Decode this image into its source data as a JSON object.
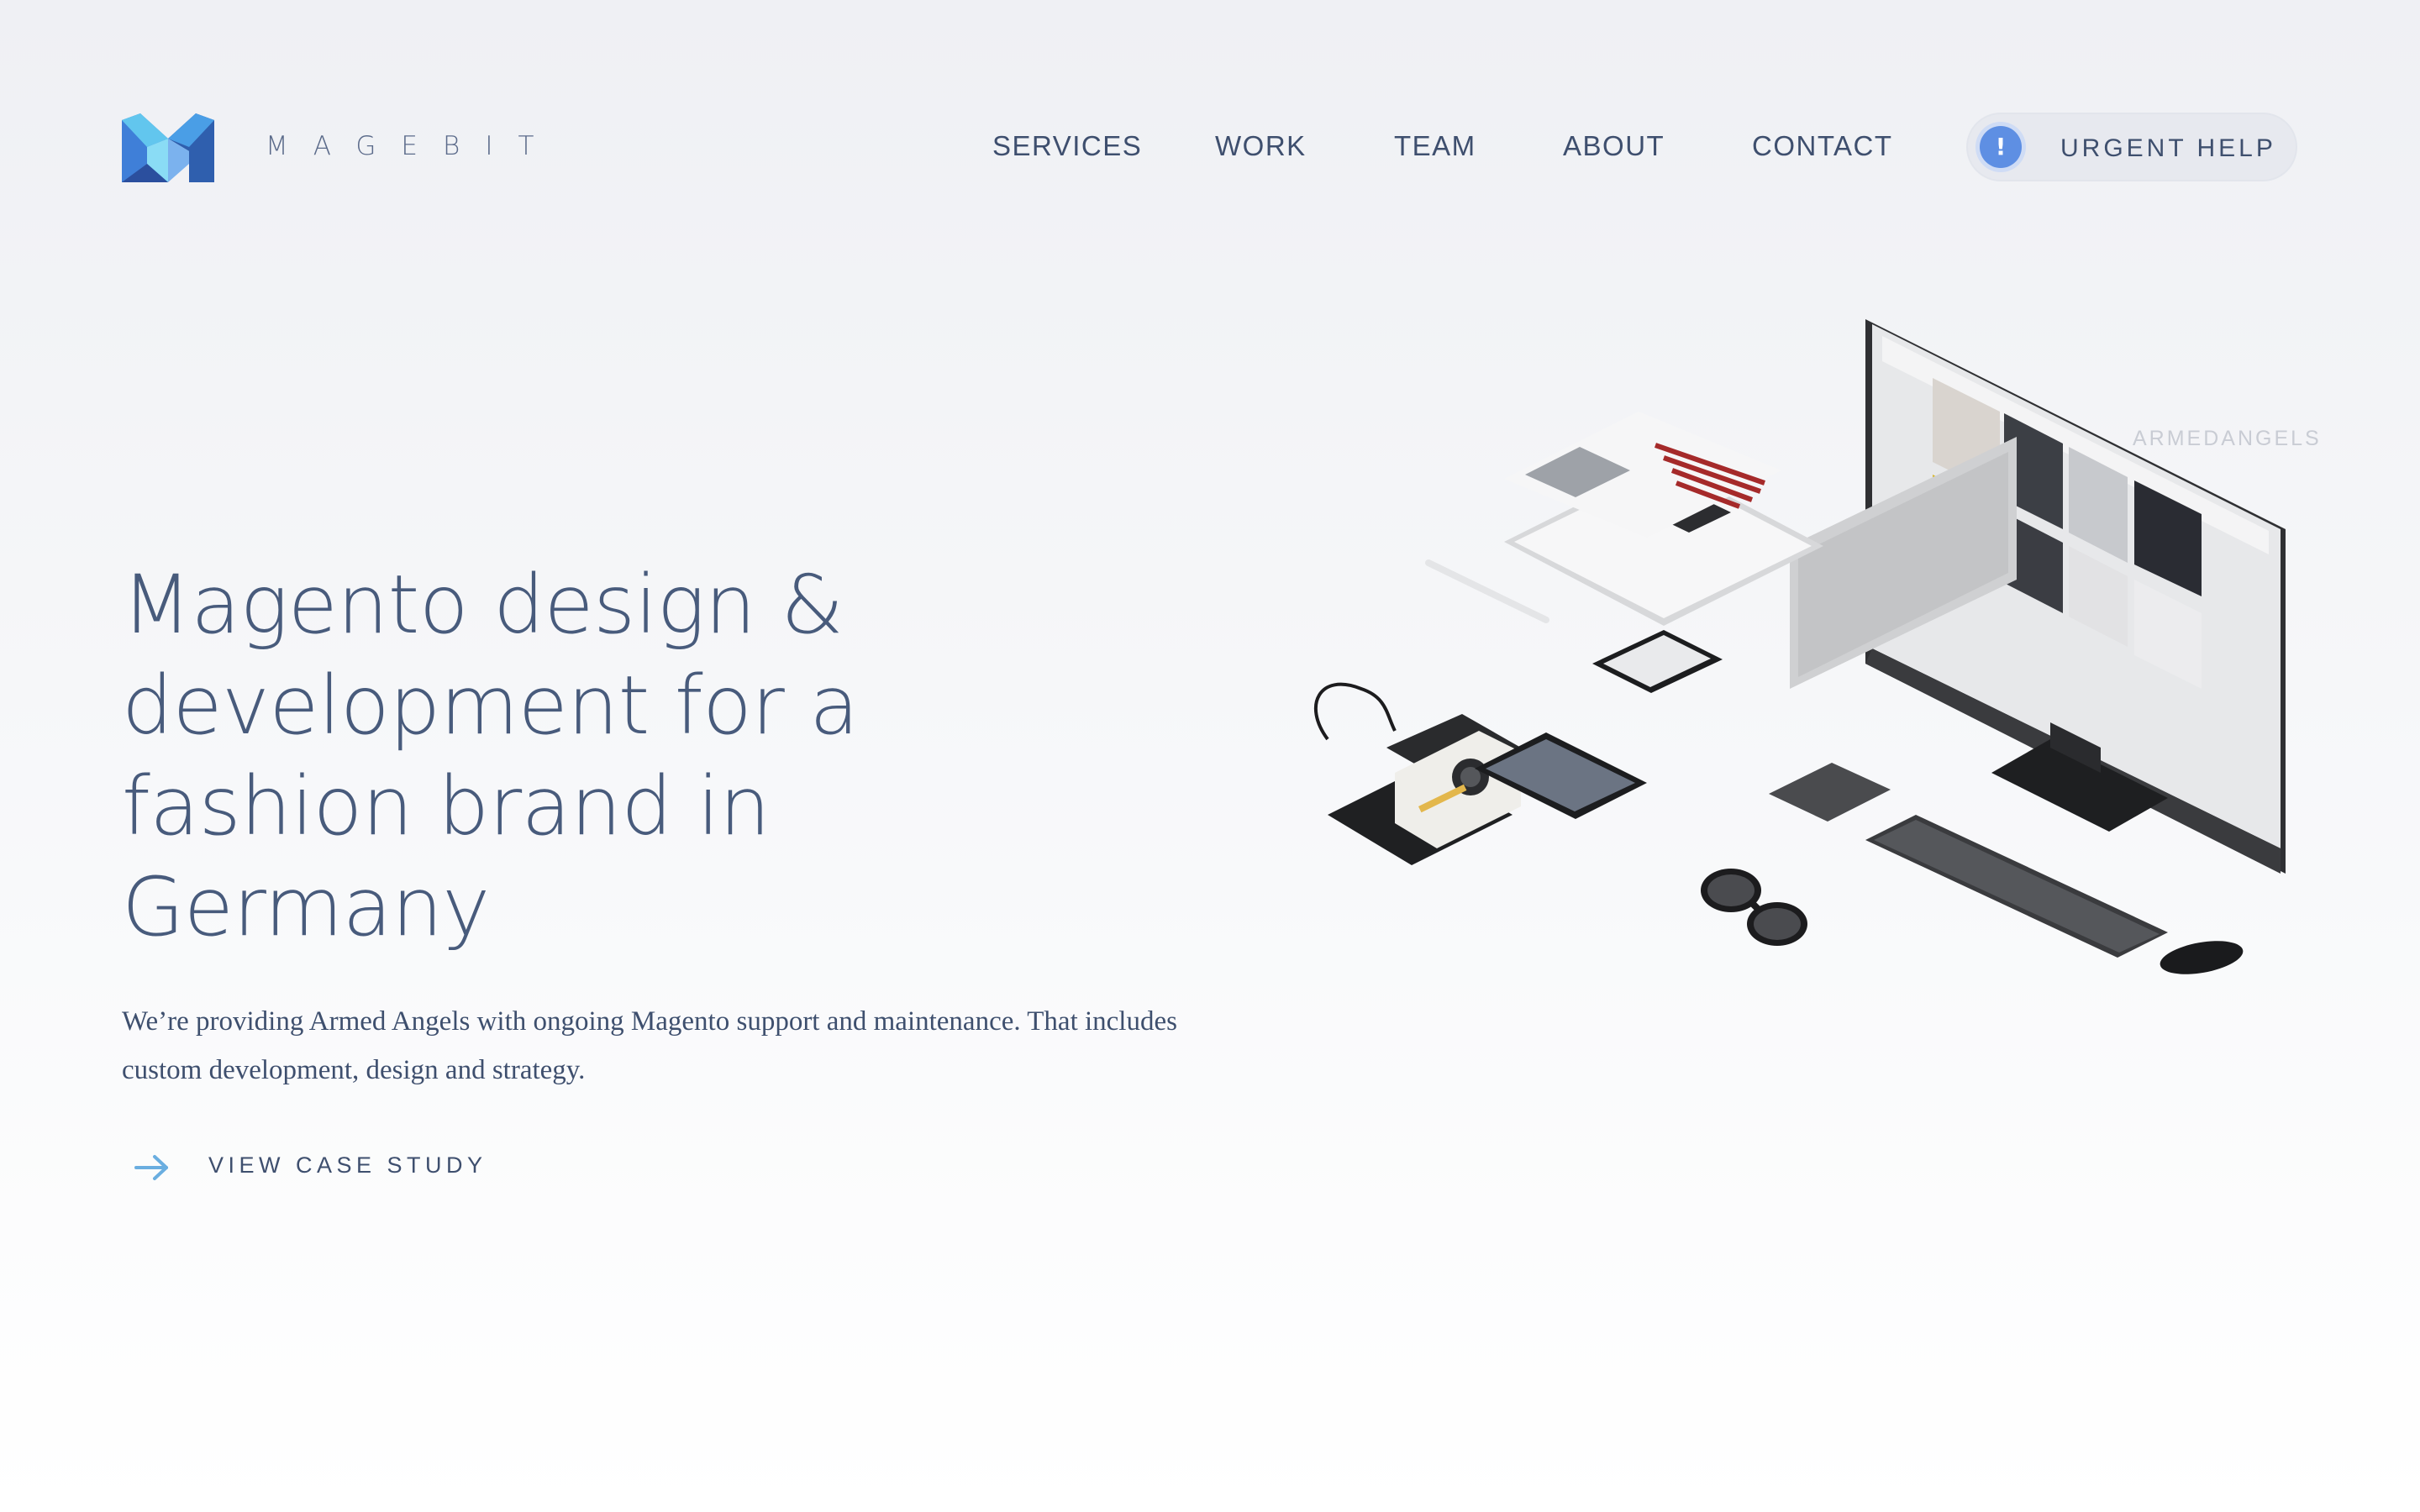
{
  "brand": {
    "logo_icon": "magebit-m-logo",
    "name": "MAGEBIT",
    "colors": {
      "logo_blue": "#3f7fd8",
      "logo_cyan": "#5fc8ee",
      "logo_dark": "#2b4f9e"
    }
  },
  "nav": {
    "items": [
      {
        "label": "SERVICES"
      },
      {
        "label": "WORK"
      },
      {
        "label": "TEAM"
      },
      {
        "label": "ABOUT"
      },
      {
        "label": "CONTACT"
      }
    ],
    "urgent": {
      "icon": "exclamation-icon",
      "symbol": "!",
      "label": "URGENT HELP",
      "accent": "#5e8fe3"
    }
  },
  "hero": {
    "title": "Magento design & development for a fashion brand in Germany",
    "description": "We’re providing Armed Angels with ongoing Magento support and maintenance. That includes custom development, design and strategy.",
    "cta": {
      "icon": "arrow-right-icon",
      "label": "VIEW CASE STUDY"
    }
  },
  "illustration": {
    "watermark": "ARMEDANGELS",
    "objects": [
      "desktop-monitor",
      "keyboard",
      "mouse",
      "trackpad",
      "sunglasses",
      "instant-camera",
      "smartphone",
      "tablet",
      "stylus",
      "print-card",
      "paper-sheet"
    ]
  }
}
